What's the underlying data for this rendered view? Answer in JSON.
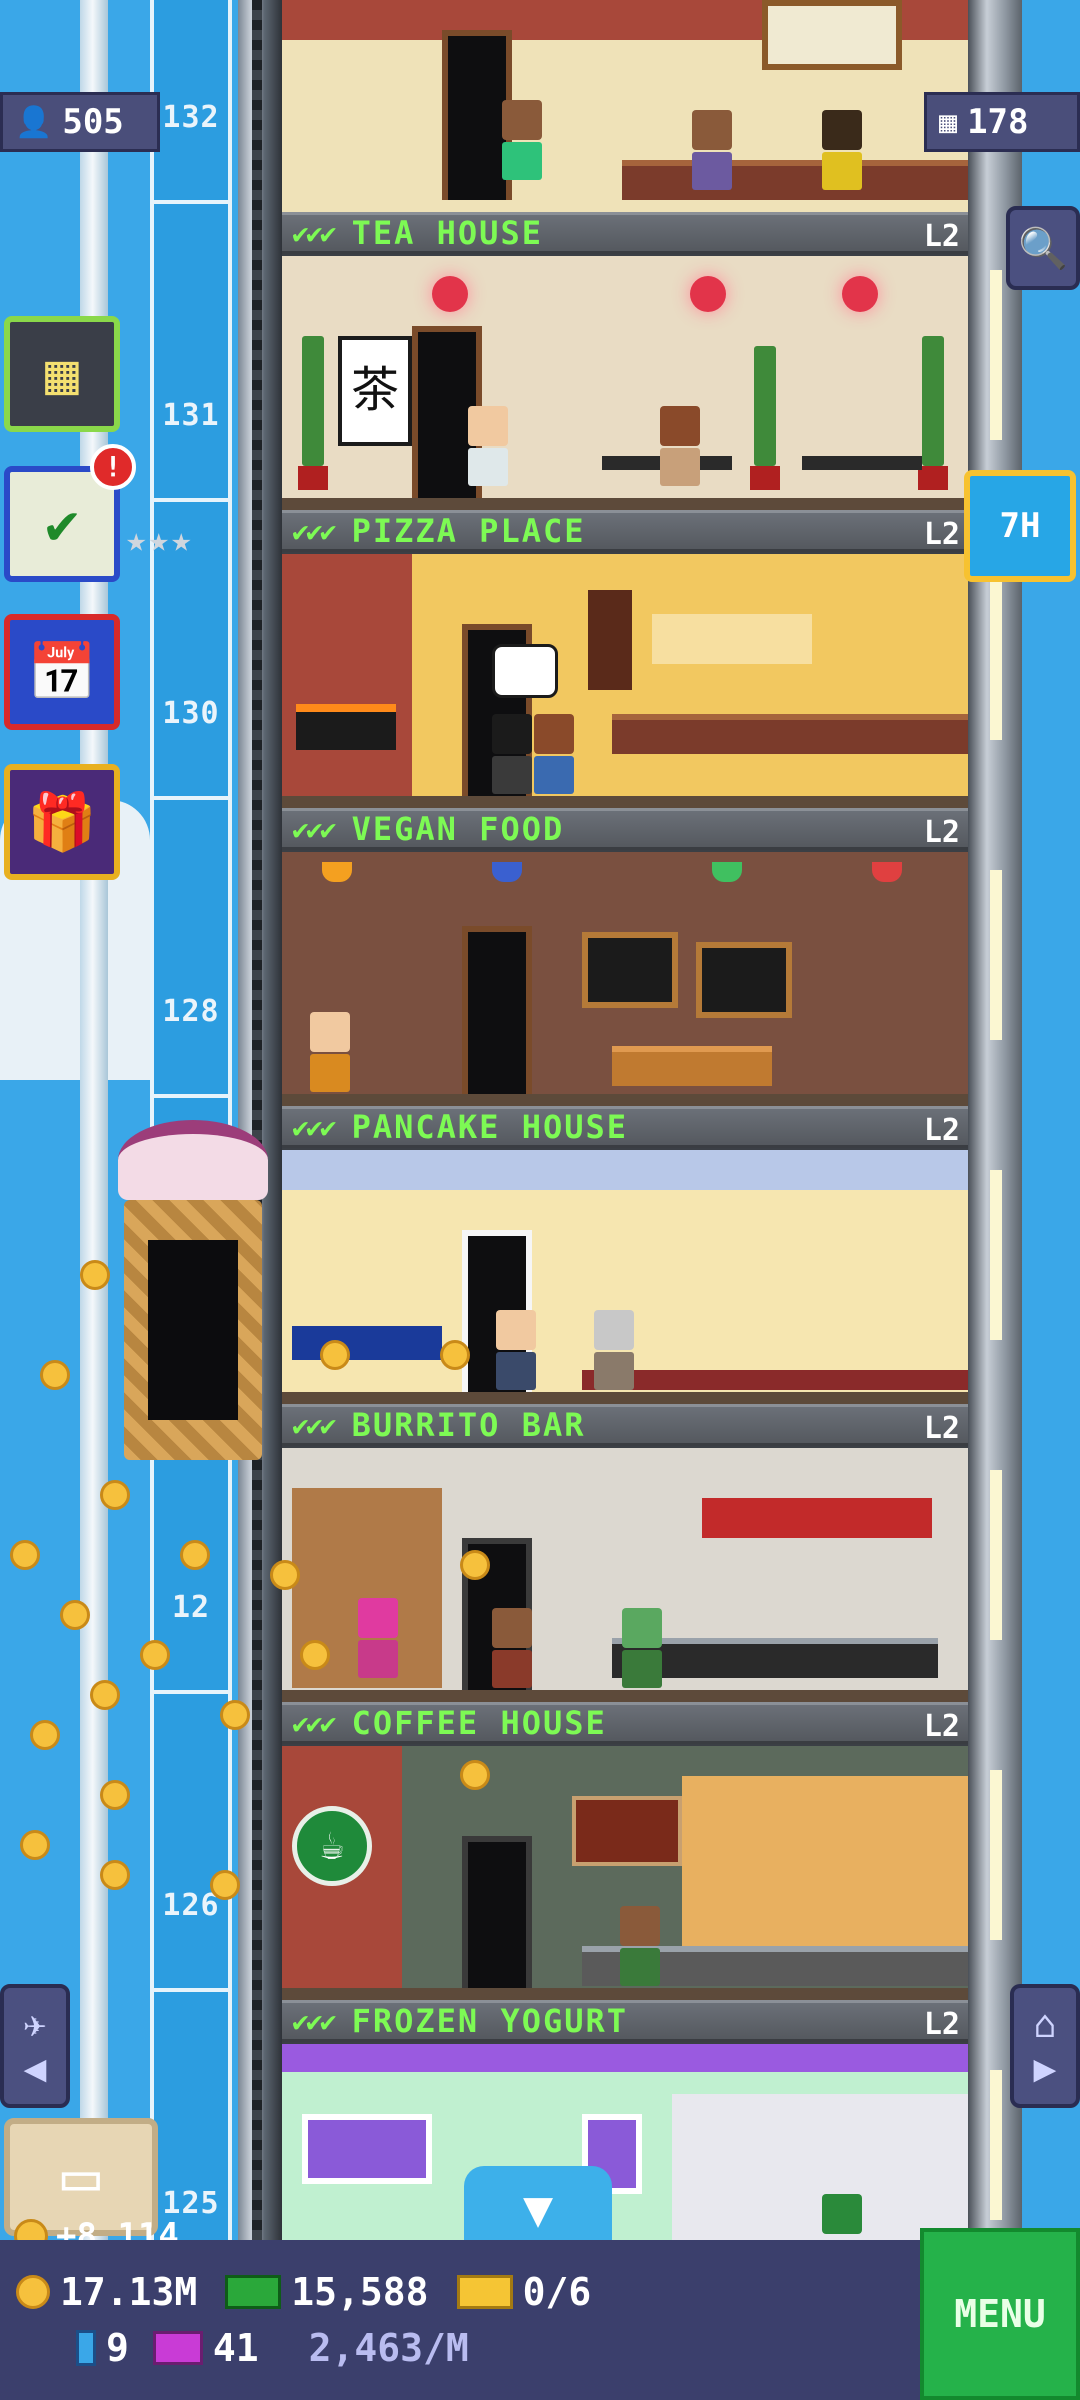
{
  "hud_top": {
    "population": "505",
    "floors": "178",
    "timer": "7H"
  },
  "floor_numbers": [
    "132",
    "131",
    "130",
    "128",
    "126",
    "125",
    "12"
  ],
  "floors": [
    {
      "name": "TEA HOUSE",
      "level": "L2",
      "checks": "✔✔✔"
    },
    {
      "name": "PIZZA PLACE",
      "level": "L2",
      "checks": "✔✔✔"
    },
    {
      "name": "VEGAN FOOD",
      "level": "L2",
      "checks": "✔✔✔"
    },
    {
      "name": "PANCAKE HOUSE",
      "level": "L2",
      "checks": "✔✔✔"
    },
    {
      "name": "BURRITO BAR",
      "level": "L2",
      "checks": "✔✔✔"
    },
    {
      "name": "COFFEE HOUSE",
      "level": "L2",
      "checks": "✔✔✔"
    },
    {
      "name": "FROZEN YOGURT",
      "level": "L2",
      "checks": "✔✔✔"
    }
  ],
  "side_icons": {
    "tower_icon": "building-icon",
    "mission_icon": "checklist-icon",
    "calendar_icon": "calendar-icon",
    "gift_icon": "gift-icon",
    "alert_badge": "!",
    "stars": "★★★"
  },
  "hud_bottom": {
    "gain": "+8,114",
    "coins": "17.13M",
    "bux_cash": "15,588",
    "tickets": "0/6",
    "tower_bux": "9",
    "vip": "41",
    "rate": "2,463/M",
    "menu_label": "MENU"
  },
  "colors": {
    "sky": "#3aa7e8",
    "label_green": "#7dfa54",
    "hud_bg": "#3b3f6c",
    "menu_green": "#25b24a",
    "timer_border": "#f7c230"
  }
}
